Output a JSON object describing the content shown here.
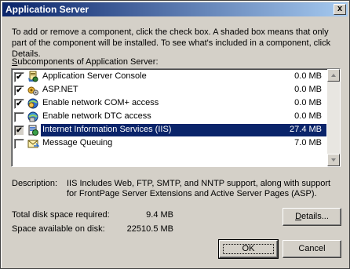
{
  "window": {
    "title": "Application Server",
    "close_glyph": "x"
  },
  "intro": {
    "text": "To add or remove a component, click the check box. A shaded box means that only part of the component will be installed. To see what's included in a component, click Details."
  },
  "subcomponents": {
    "label_prefix": "S",
    "label_rest": "ubcomponents of Application Server:",
    "items": [
      {
        "name": "Application Server Console",
        "size": "0.0 MB",
        "checked": true,
        "shaded": false,
        "icon": "console-icon"
      },
      {
        "name": "ASP.NET",
        "size": "0.0 MB",
        "checked": true,
        "shaded": false,
        "icon": "aspnet-icon"
      },
      {
        "name": "Enable network COM+ access",
        "size": "0.0 MB",
        "checked": true,
        "shaded": false,
        "icon": "com-plus-icon"
      },
      {
        "name": "Enable network DTC access",
        "size": "0.0 MB",
        "checked": false,
        "shaded": false,
        "icon": "dtc-icon"
      },
      {
        "name": "Internet Information Services (IIS)",
        "size": "27.4 MB",
        "checked": true,
        "shaded": true,
        "icon": "iis-icon",
        "selected": true
      },
      {
        "name": "Message Queuing",
        "size": "7.0 MB",
        "checked": false,
        "shaded": false,
        "icon": "message-queuing-icon"
      }
    ],
    "check_glyph": "✔"
  },
  "description": {
    "label": "Description:",
    "text": "IIS Includes Web, FTP, SMTP, and NNTP support, along with support for FrontPage Server Extensions and Active Server Pages (ASP)."
  },
  "disk": {
    "required_label": "Total disk space required:",
    "required_value": "9.4 MB",
    "available_label": "Space available on disk:",
    "available_value": "22510.5 MB"
  },
  "buttons": {
    "details_prefix": "D",
    "details_rest": "etails...",
    "ok": "OK",
    "cancel": "Cancel"
  },
  "colors": {
    "title_gradient_start": "#0a246a",
    "selection": "#0a246a",
    "face": "#d4d0c8"
  }
}
